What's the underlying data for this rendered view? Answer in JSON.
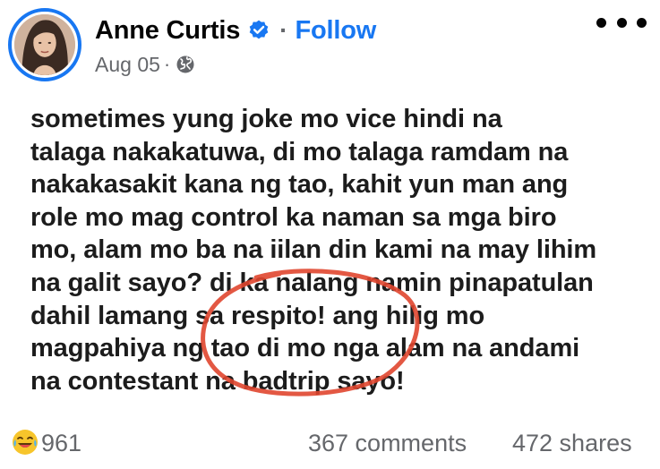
{
  "post": {
    "author": {
      "name": "Anne Curtis",
      "verified_icon": "verified-badge-icon",
      "follow_label": "Follow",
      "separator": "·"
    },
    "meta": {
      "date": "Aug 05",
      "separator": "·",
      "privacy_icon": "globe-icon"
    },
    "more_icon": "more-options-icon",
    "body_lines": [
      "sometimes yung joke mo vice hindi na",
      "talaga nakakatuwa, di mo talaga ramdam na",
      "nakakasakit kana ng tao, kahit yun man ang",
      "role mo mag control ka naman sa mga biro",
      "mo, alam mo ba na iilan din kami na may lihim",
      "na galit sayo? di ka nalang namin pinapatulan",
      "dahil lamang sa respito! ang hilig mo",
      "magpahiya ng tao di mo nga alam na andami",
      "na contestant na badtrip sayo!"
    ],
    "annotation": {
      "type": "red-circle",
      "color": "#e0462f"
    },
    "footer": {
      "reaction_icon": "laugh-cry-emoji-icon",
      "reaction_count": "961",
      "comments": "367 comments",
      "shares": "472 shares"
    }
  },
  "colors": {
    "accent": "#1877f2",
    "secondary_text": "#65676b",
    "annotation_red": "#e0462f"
  }
}
